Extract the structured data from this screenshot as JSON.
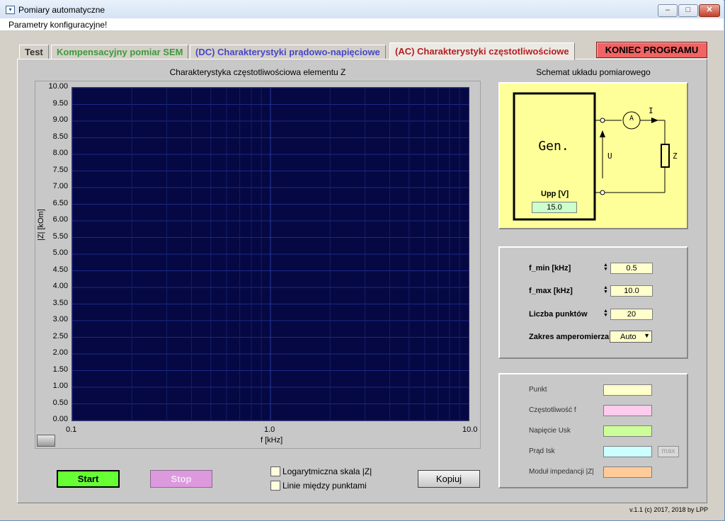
{
  "window": {
    "title": "Pomiary automatyczne",
    "minimize": "–",
    "maximize": "□",
    "close": "✕"
  },
  "menu": {
    "config": "Parametry konfiguracyjne!"
  },
  "tabs": [
    {
      "label": "Test",
      "color": "#333333"
    },
    {
      "label": "Kompensacyjny pomiar SEM",
      "color": "#3c9a3c"
    },
    {
      "label": "(DC) Charakterystyki prądowo-napięciowe",
      "color": "#4646c8"
    },
    {
      "label": "(AC) Charakterystyki częstotliwościowe",
      "color": "#b41e1e"
    }
  ],
  "end_button": "KONIEC PROGRAMU",
  "chart": {
    "title": "Charakterystyka częstotliwościowa elementu Z",
    "ylabel": "|Z| [kOm]",
    "xlabel": "f [kHz]",
    "yticks": [
      "10.00",
      "9.50",
      "9.00",
      "8.50",
      "8.00",
      "7.50",
      "7.00",
      "6.50",
      "6.00",
      "5.50",
      "5.00",
      "4.50",
      "4.00",
      "3.50",
      "3.00",
      "2.50",
      "2.00",
      "1.50",
      "1.00",
      "0.50",
      "0.00"
    ],
    "xticks": [
      "0.1",
      "1.0",
      "10.0"
    ]
  },
  "chart_data": {
    "type": "scatter",
    "title": "Charakterystyka częstotliwościowa elementu Z",
    "xlabel": "f [kHz]",
    "ylabel": "|Z| [kOm]",
    "xscale": "log",
    "xlim": [
      0.1,
      10.0
    ],
    "ylim": [
      0.0,
      10.0
    ],
    "grid": true,
    "series": []
  },
  "scheme": {
    "title": "Schemat układu pomiarowego",
    "gen": "Gen.",
    "upp_label": "Upp [V]",
    "upp_value": "15.0",
    "ammeter": "A",
    "current": "I",
    "voltage": "U",
    "impedance": "Z"
  },
  "params": {
    "fmin_label": "f_min [kHz]",
    "fmin_value": "0.5",
    "fmax_label": "f_max [kHz]",
    "fmax_value": "10.0",
    "points_label": "Liczba punktów",
    "points_value": "20",
    "range_label": "Zakres amperomierza",
    "range_value": "Auto"
  },
  "indicators": {
    "point": "Punkt",
    "freq": "Częstotliwość f",
    "voltage": "Napięcie Usk",
    "current": "Prąd Isk",
    "max_button": "max",
    "impedance": "Moduł impedancji |Z|",
    "colors": {
      "point": "#ffffcc",
      "freq": "#ffccee",
      "voltage": "#ccff99",
      "current": "#ccffff",
      "impedance": "#ffcc99"
    }
  },
  "controls": {
    "start": "Start",
    "stop": "Stop",
    "log_scale": "Logarytmiczna skala |Z|",
    "lines": "Linie między punktami",
    "copy": "Kopiuj"
  },
  "version": "v.1.1  (c) 2017, 2018 by LPP"
}
